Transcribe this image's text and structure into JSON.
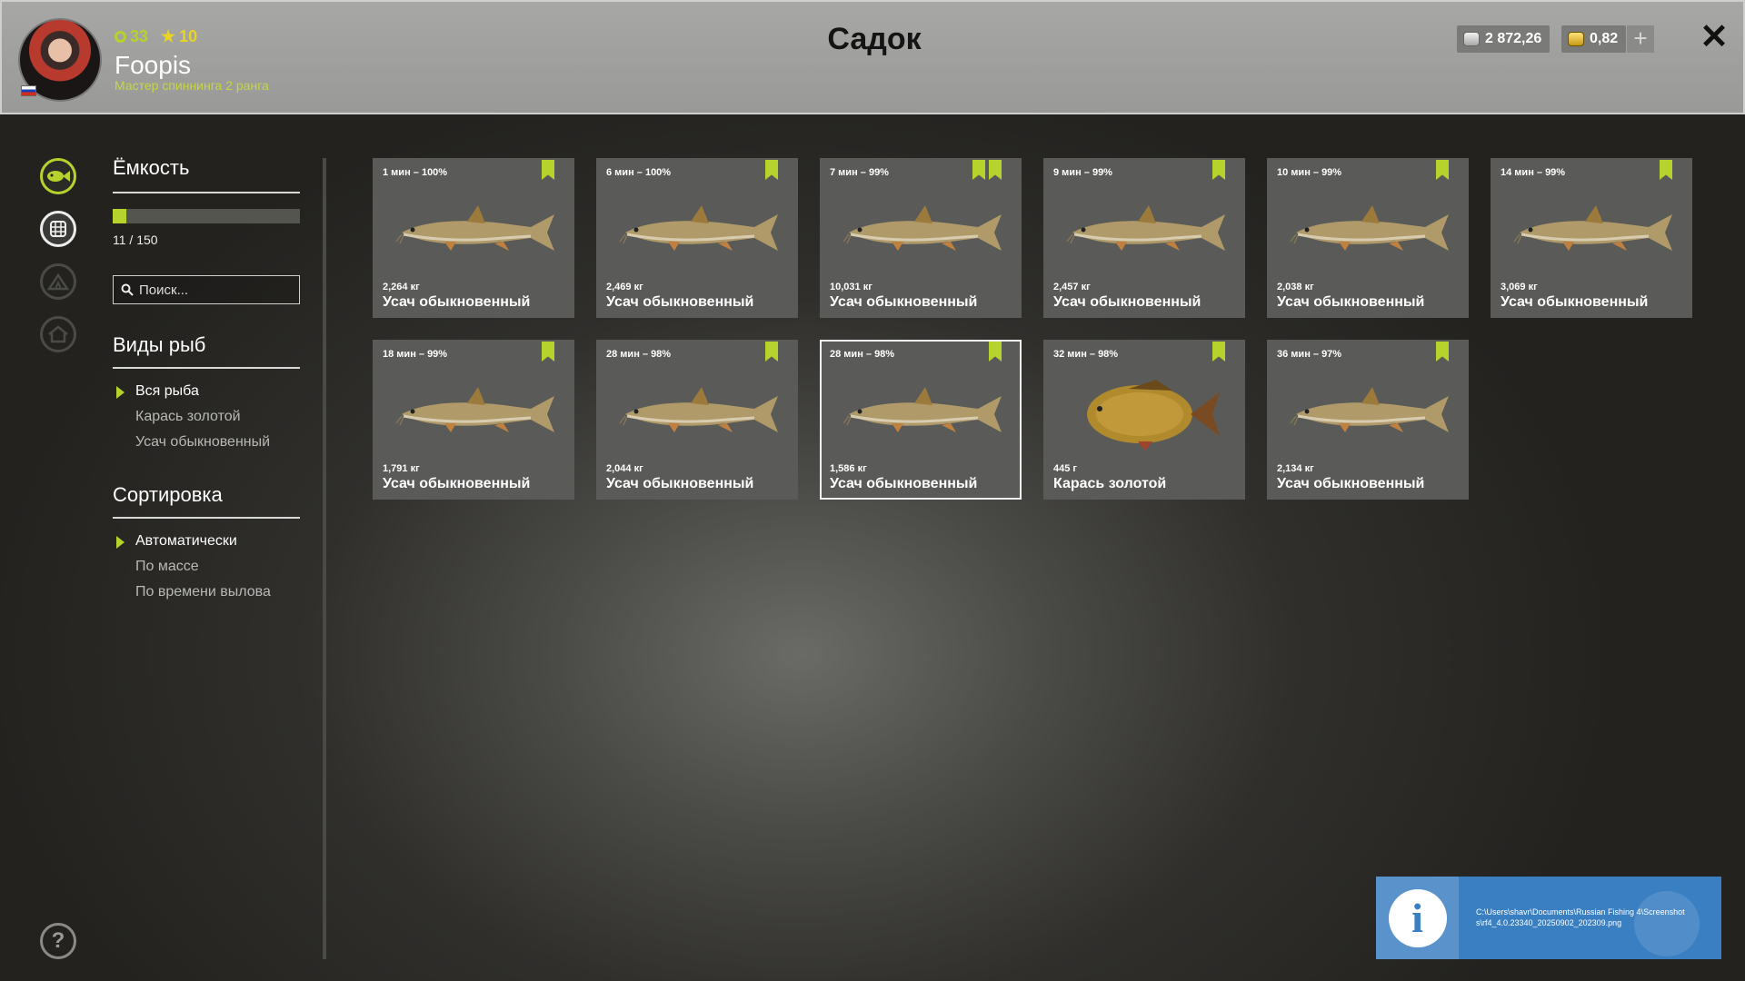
{
  "header": {
    "title": "Садок",
    "player": {
      "level": "33",
      "stars": "10",
      "name": "Foopis",
      "rank_title": "Мастер спиннинга 2 ранга"
    },
    "currency_silver": "2 872,26",
    "currency_gold": "0,82"
  },
  "capacity": {
    "title": "Ёмкость",
    "used": 11,
    "max": 150,
    "text": "11 / 150"
  },
  "search": {
    "placeholder": "Поиск..."
  },
  "species_filter": {
    "title": "Виды рыб",
    "items": [
      "Вся рыба",
      "Карась золотой",
      "Усач обыкновенный"
    ],
    "selected_index": 0
  },
  "sort": {
    "title": "Сортировка",
    "items": [
      "Автоматически",
      "По массе",
      "По времени вылова"
    ],
    "selected_index": 0
  },
  "fish": [
    {
      "time": "1 мин – 100%",
      "weight": "2,264 кг",
      "name": "Усач обыкновенный",
      "species": "barbel",
      "bookmarks": [
        "check"
      ]
    },
    {
      "time": "6 мин – 100%",
      "weight": "2,469 кг",
      "name": "Усач обыкновенный",
      "species": "barbel",
      "bookmarks": [
        "check"
      ]
    },
    {
      "time": "7 мин – 99%",
      "weight": "10,031 кг",
      "name": "Усач обыкновенный",
      "species": "barbel",
      "bookmarks": [
        "check",
        "star"
      ]
    },
    {
      "time": "9 мин – 99%",
      "weight": "2,457 кг",
      "name": "Усач обыкновенный",
      "species": "barbel",
      "bookmarks": [
        "check"
      ]
    },
    {
      "time": "10 мин – 99%",
      "weight": "2,038 кг",
      "name": "Усач обыкновенный",
      "species": "barbel",
      "bookmarks": [
        "check"
      ]
    },
    {
      "time": "14 мин – 99%",
      "weight": "3,069 кг",
      "name": "Усач обыкновенный",
      "species": "barbel",
      "bookmarks": [
        "check"
      ]
    },
    {
      "time": "18 мин – 99%",
      "weight": "1,791 кг",
      "name": "Усач обыкновенный",
      "species": "barbel",
      "bookmarks": [
        "check"
      ]
    },
    {
      "time": "28 мин – 98%",
      "weight": "2,044 кг",
      "name": "Усач обыкновенный",
      "species": "barbel",
      "bookmarks": [
        "check"
      ]
    },
    {
      "time": "28 мин – 98%",
      "weight": "1,586 кг",
      "name": "Усач обыкновенный",
      "species": "barbel",
      "bookmarks": [
        "check"
      ],
      "selected": true
    },
    {
      "time": "32 мин – 98%",
      "weight": "445 г",
      "name": "Карась золотой",
      "species": "crucian",
      "bookmarks": [
        "check"
      ]
    },
    {
      "time": "36 мин – 97%",
      "weight": "2,134 кг",
      "name": "Усач обыкновенный",
      "species": "barbel",
      "bookmarks": [
        "check"
      ]
    }
  ],
  "notification": {
    "text": "C:\\Users\\shavr\\Documents\\Russian Fishing 4\\Screenshots\\rf4_4.0.23340_20250902_202309.png"
  },
  "colors": {
    "accent": "#b6d22c",
    "card_bg": "#5a5a58",
    "header_bg": "#a0a09e",
    "notification_bg": "#3a7fc2"
  },
  "icons": {
    "nav": [
      "fish-icon",
      "keepnet-icon",
      "tent-icon",
      "home-icon"
    ],
    "help": "help-icon",
    "close": "close-icon"
  }
}
